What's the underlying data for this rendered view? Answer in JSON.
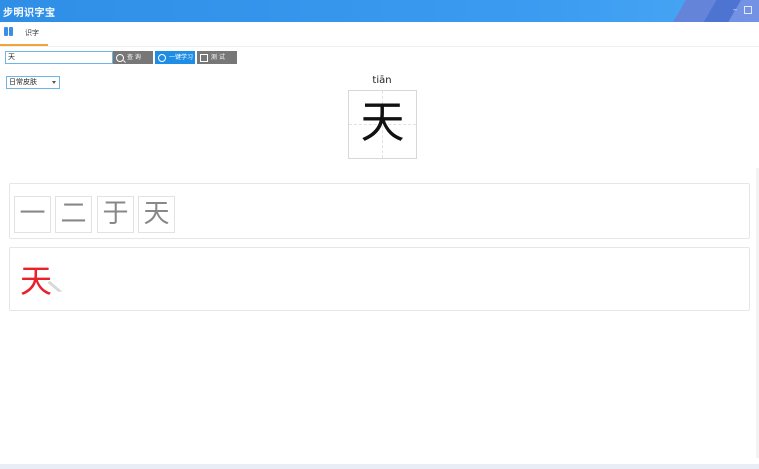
{
  "window": {
    "title": "步明识字宝",
    "minimize_glyph": "–"
  },
  "tabs": [
    {
      "label": "识字"
    }
  ],
  "toolbar": {
    "search_value": "天",
    "search_label": "查 询",
    "learn_label": "一键学习",
    "test_label": "测 试"
  },
  "skin": {
    "selected": "日常皮肤"
  },
  "character": {
    "pinyin": "tiān",
    "glyph": "天"
  },
  "stroke_order": [
    "一",
    "二",
    "于",
    "天"
  ],
  "animation": {
    "glyph": "天"
  },
  "colors": {
    "titlebar": "#3a9bf0",
    "accent": "#1e8de6",
    "tab_underline": "#f0a43a",
    "stroke_highlight": "#e8212a"
  }
}
